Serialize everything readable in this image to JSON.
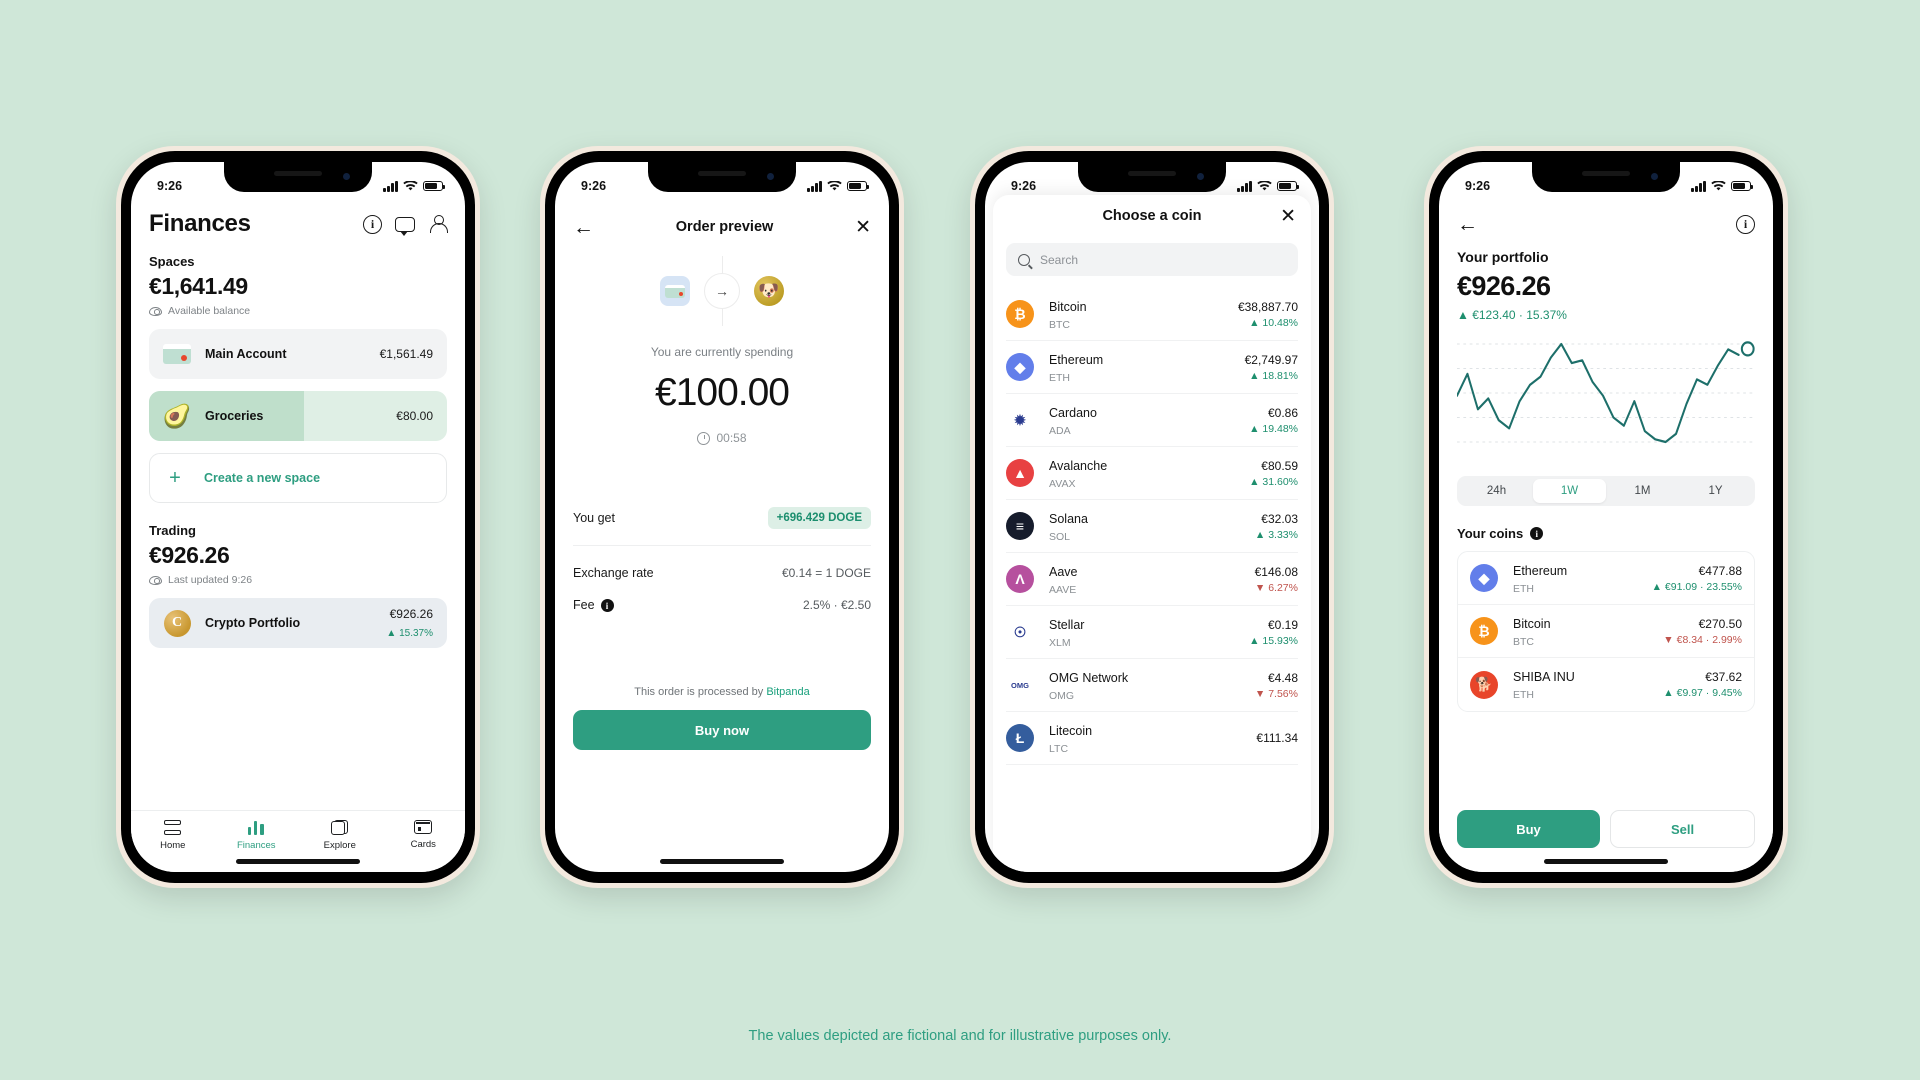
{
  "page": {
    "background": "#cfe7d8",
    "accent": "#2e9e81",
    "footnote": "The values depicted are fictional and for illustrative purposes only."
  },
  "status_bar": {
    "time": "9:26"
  },
  "phone1": {
    "title": "Finances",
    "icons": [
      "info-icon",
      "chat-icon",
      "person-icon"
    ],
    "spaces": {
      "label": "Spaces",
      "amount": "€1,641.49",
      "subtitle": "Available balance",
      "rows": [
        {
          "name": "Main Account",
          "value": "€1,561.49",
          "icon": "card-icon"
        },
        {
          "name": "Groceries",
          "value": "€80.00",
          "icon": "avocado-icon",
          "progress": 52
        }
      ],
      "create_label": "Create a new space"
    },
    "trading": {
      "label": "Trading",
      "amount": "€926.26",
      "subtitle": "Last updated 9:26",
      "rows": [
        {
          "name": "Crypto Portfolio",
          "value": "€926.26",
          "change": "▲ 15.37%",
          "icon": "gold-coin-icon"
        }
      ]
    },
    "tabs": [
      {
        "label": "Home",
        "icon": "home-icon",
        "active": false
      },
      {
        "label": "Finances",
        "icon": "bars-icon",
        "active": true
      },
      {
        "label": "Explore",
        "icon": "explore-icon",
        "active": false
      },
      {
        "label": "Cards",
        "icon": "cards-icon",
        "active": false
      }
    ]
  },
  "phone2": {
    "title": "Order preview",
    "back": "←",
    "close": "✕",
    "swap": {
      "from_icon": "card-icon",
      "arrow": "→",
      "to_icon": "doge-icon"
    },
    "spend_label": "You are currently spending",
    "spend_amount": "€100.00",
    "timer": "00:58",
    "you_get_label": "You get",
    "you_get_value": "+696.429 DOGE",
    "exchange_rate_label": "Exchange rate",
    "exchange_rate_value": "€0.14 = 1 DOGE",
    "fee_label": "Fee",
    "fee_value": "2.5% · €2.50",
    "processed_prefix": "This order is processed by ",
    "processed_brand": "Bitpanda",
    "cta": "Buy now"
  },
  "phone3": {
    "title": "Choose a coin",
    "close": "✕",
    "search_placeholder": "Search",
    "coins": [
      {
        "name": "Bitcoin",
        "symbol": "BTC",
        "price": "€38,887.70",
        "change": "▲ 10.48%",
        "dir": "up",
        "color": "#f7931a",
        "glyph": "₿"
      },
      {
        "name": "Ethereum",
        "symbol": "ETH",
        "price": "€2,749.97",
        "change": "▲ 18.81%",
        "dir": "up",
        "color": "#627eea",
        "glyph": "◆"
      },
      {
        "name": "Cardano",
        "symbol": "ADA",
        "price": "€0.86",
        "change": "▲ 19.48%",
        "dir": "up",
        "color": "#ffffff",
        "glyph": "✹"
      },
      {
        "name": "Avalanche",
        "symbol": "AVAX",
        "price": "€80.59",
        "change": "▲ 31.60%",
        "dir": "up",
        "color": "#e84142",
        "glyph": "▲"
      },
      {
        "name": "Solana",
        "symbol": "SOL",
        "price": "€32.03",
        "change": "▲ 3.33%",
        "dir": "up",
        "color": "#161c2c",
        "glyph": "≡"
      },
      {
        "name": "Aave",
        "symbol": "AAVE",
        "price": "€146.08",
        "change": "▼ 6.27%",
        "dir": "down",
        "color": "#b6509e",
        "glyph": "Λ"
      },
      {
        "name": "Stellar",
        "symbol": "XLM",
        "price": "€0.19",
        "change": "▲ 15.93%",
        "dir": "up",
        "color": "#ffffff",
        "glyph": "☉"
      },
      {
        "name": "OMG Network",
        "symbol": "OMG",
        "price": "€4.48",
        "change": "▼ 7.56%",
        "dir": "down",
        "color": "#ffffff",
        "glyph": "OMG"
      },
      {
        "name": "Litecoin",
        "symbol": "LTC",
        "price": "€111.34",
        "change": "",
        "dir": "up",
        "color": "#345d9d",
        "glyph": "Ł"
      }
    ]
  },
  "phone4": {
    "back": "←",
    "info": "info-icon",
    "title": "Your portfolio",
    "amount": "€926.26",
    "delta": "▲ €123.40 · 15.37%",
    "ranges": [
      {
        "label": "24h",
        "active": false
      },
      {
        "label": "1W",
        "active": true
      },
      {
        "label": "1M",
        "active": false
      },
      {
        "label": "1Y",
        "active": false
      }
    ],
    "your_coins_label": "Your coins",
    "coins": [
      {
        "name": "Ethereum",
        "symbol": "ETH",
        "value": "€477.88",
        "change": "▲ €91.09 · 23.55%",
        "dir": "up",
        "color": "#627eea",
        "glyph": "◆"
      },
      {
        "name": "Bitcoin",
        "symbol": "BTC",
        "value": "€270.50",
        "change": "▼ €8.34 · 2.99%",
        "dir": "down",
        "color": "#f7931a",
        "glyph": "₿"
      },
      {
        "name": "SHIBA INU",
        "symbol": "ETH",
        "value": "€37.62",
        "change": "▲ €9.97 · 9.45%",
        "dir": "up",
        "color": "#e8452a",
        "glyph": "🐕"
      }
    ],
    "buy_label": "Buy",
    "sell_label": "Sell"
  },
  "chart_data": {
    "type": "line",
    "title": "Your portfolio",
    "xlabel": "",
    "ylabel": "",
    "series": [
      {
        "name": "Portfolio value",
        "color": "#1d6f6a",
        "x": [
          0,
          1,
          2,
          3,
          4,
          5,
          6,
          7,
          8,
          9,
          10,
          11,
          12,
          13,
          14,
          15,
          16,
          17,
          18,
          19,
          20,
          21,
          22,
          23,
          24,
          25,
          26,
          27
        ],
        "values": [
          62,
          78,
          52,
          60,
          44,
          38,
          58,
          70,
          76,
          90,
          100,
          86,
          88,
          72,
          62,
          46,
          40,
          58,
          36,
          30,
          28,
          34,
          56,
          74,
          70,
          84,
          96,
          92
        ]
      }
    ],
    "grid": true,
    "gridlines": 5,
    "legend": "none",
    "endpoint_marker": true,
    "range_selected": "1W"
  }
}
